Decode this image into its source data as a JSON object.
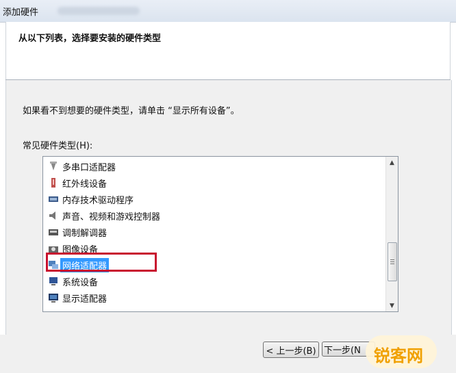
{
  "window": {
    "title": "添加硬件"
  },
  "header": {
    "text": "从以下列表，选择要安装的硬件类型"
  },
  "instruction": "如果看不到想要的硬件类型，请单击 “显示所有设备”。",
  "list": {
    "label": "常见硬件类型(H):",
    "items": [
      {
        "label": "多串口适配器",
        "icon": "multiport-icon"
      },
      {
        "label": "红外线设备",
        "icon": "infrared-icon"
      },
      {
        "label": "内存技术驱动程序",
        "icon": "memory-icon"
      },
      {
        "label": "声音、视频和游戏控制器",
        "icon": "sound-icon"
      },
      {
        "label": "调制解调器",
        "icon": "modem-icon"
      },
      {
        "label": "图像设备",
        "icon": "camera-icon"
      },
      {
        "label": "网络适配器",
        "icon": "network-icon",
        "selected": true
      },
      {
        "label": "系统设备",
        "icon": "system-icon"
      },
      {
        "label": "显示适配器",
        "icon": "display-icon"
      }
    ]
  },
  "buttons": {
    "back": "< 上一步(B)",
    "next": "下一步(N"
  },
  "watermark": "锐客网",
  "colors": {
    "highlight_border": "#c8102e",
    "selection": "#3399ff"
  }
}
